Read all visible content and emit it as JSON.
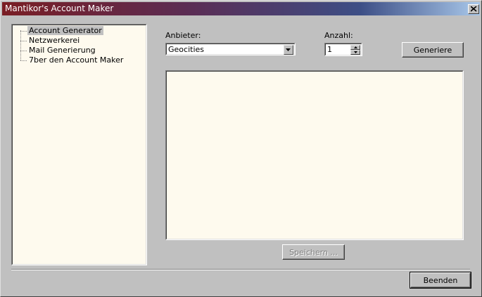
{
  "window": {
    "title": "Mantikor's Account Maker"
  },
  "tree": {
    "items": [
      {
        "label": "Account Generator",
        "selected": true
      },
      {
        "label": "Netzwerkerei",
        "selected": false
      },
      {
        "label": "Mail Generierung",
        "selected": false
      },
      {
        "label": "7ber den Account Maker",
        "selected": false
      }
    ]
  },
  "form": {
    "provider_label": "Anbieter:",
    "provider_value": "Geocities",
    "count_label": "Anzahl:",
    "count_value": "1"
  },
  "buttons": {
    "generate": "Generiere",
    "save": "Speichern ...",
    "quit": "Beenden"
  },
  "colors": {
    "list_background": "#fefaee",
    "titlebar_start": "#7a1e24",
    "titlebar_end": "#a9c8ea"
  }
}
